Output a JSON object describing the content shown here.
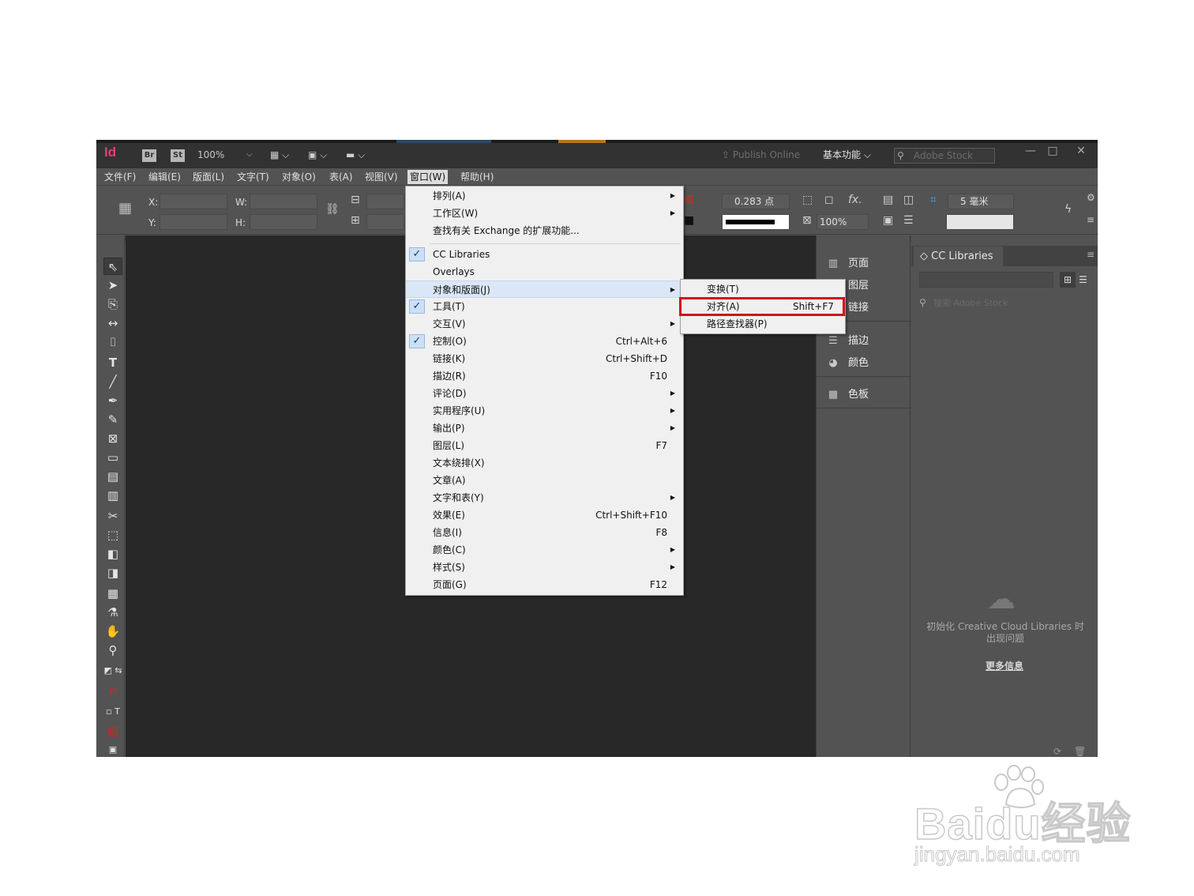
{
  "titlebar": {
    "app_icon": "Id",
    "bridge_chip": "Br",
    "stock_chip": "St",
    "zoom": "100%",
    "publish_online": "Publish Online",
    "workspace": "基本功能",
    "stock_search_placeholder": "Adobe Stock",
    "minimize": "—",
    "maximize": "□",
    "close": "✕"
  },
  "menubar": {
    "items": [
      "文件(F)",
      "编辑(E)",
      "版面(L)",
      "文字(T)",
      "对象(O)",
      "表(A)",
      "视图(V)",
      "窗口(W)",
      "帮助(H)"
    ],
    "active_index": 7
  },
  "controlbar": {
    "x_label": "X:",
    "y_label": "Y:",
    "w_label": "W:",
    "h_label": "H:",
    "stroke_weight": "0.283 点",
    "opacity": "100%",
    "gap": "5 毫米"
  },
  "window_menu": {
    "items": [
      {
        "label": "排列(A)",
        "submenu": true
      },
      {
        "label": "工作区(W)",
        "submenu": true
      },
      {
        "label": "查找有关 Exchange 的扩展功能..."
      },
      {
        "label": "CC Libraries",
        "checked": true
      },
      {
        "label": "Overlays"
      },
      {
        "label": "对象和版面(J)",
        "submenu": true,
        "highlighted": true
      },
      {
        "label": "工具(T)",
        "checked": true
      },
      {
        "label": "交互(V)",
        "submenu": true
      },
      {
        "label": "控制(O)",
        "checked": true,
        "shortcut": "Ctrl+Alt+6"
      },
      {
        "label": "链接(K)",
        "shortcut": "Ctrl+Shift+D"
      },
      {
        "label": "描边(R)",
        "shortcut": "F10"
      },
      {
        "label": "评论(D)",
        "submenu": true
      },
      {
        "label": "实用程序(U)",
        "submenu": true
      },
      {
        "label": "输出(P)",
        "submenu": true
      },
      {
        "label": "图层(L)",
        "shortcut": "F7"
      },
      {
        "label": "文本绕排(X)"
      },
      {
        "label": "文章(A)"
      },
      {
        "label": "文字和表(Y)",
        "submenu": true
      },
      {
        "label": "效果(E)",
        "shortcut": "Ctrl+Shift+F10"
      },
      {
        "label": "信息(I)",
        "shortcut": "F8"
      },
      {
        "label": "颜色(C)",
        "submenu": true
      },
      {
        "label": "样式(S)",
        "submenu": true
      },
      {
        "label": "页面(G)",
        "shortcut": "F12"
      }
    ]
  },
  "submenu": {
    "items": [
      {
        "label": "变换(T)",
        "shortcut": ""
      },
      {
        "label": "对齐(A)",
        "shortcut": "Shift+F7"
      },
      {
        "label": "路径查找器(P)",
        "shortcut": ""
      }
    ]
  },
  "dock": {
    "items": [
      {
        "label": "页面",
        "icon": "pages-icon"
      },
      {
        "label": "图层",
        "icon": "layers-icon"
      },
      {
        "label": "链接",
        "icon": "links-icon"
      },
      {
        "label": "描边",
        "icon": "stroke-icon"
      },
      {
        "label": "颜色",
        "icon": "color-icon"
      },
      {
        "label": "色板",
        "icon": "swatches-icon"
      }
    ]
  },
  "cc_libraries": {
    "tab": "CC Libraries",
    "search_placeholder": "搜索 Adobe Stock",
    "message": "初始化 Creative Cloud Libraries 时出现问题",
    "more_info": "更多信息"
  },
  "watermark": {
    "logo": "Baidu经验",
    "url": "jingyan.baidu.com"
  },
  "colors": {
    "highlight_box": "#d0111b",
    "app_bg": "#535353",
    "canvas": "#282828",
    "menu_bg": "#f0f0f0"
  }
}
